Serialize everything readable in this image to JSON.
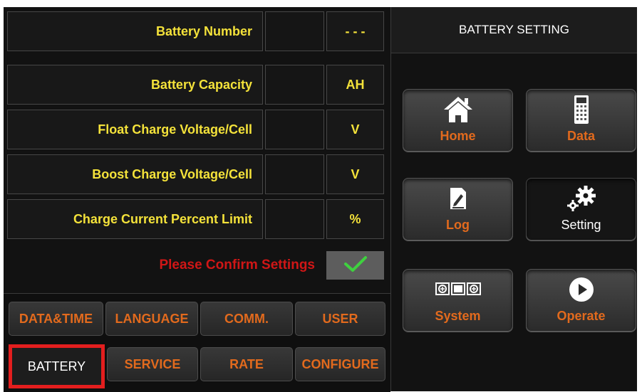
{
  "header": {
    "title": "BATTERY SETTING"
  },
  "rows": [
    {
      "label": "Battery Number",
      "value": "",
      "unit": "- - -"
    },
    {
      "label": "Battery Capacity",
      "value": "",
      "unit": "AH"
    },
    {
      "label": "Float Charge Voltage/Cell",
      "value": "",
      "unit": "V"
    },
    {
      "label": "Boost Charge Voltage/Cell",
      "value": "",
      "unit": "V"
    },
    {
      "label": "Charge Current Percent Limit",
      "value": "",
      "unit": "%"
    }
  ],
  "confirm": {
    "text": "Please Confirm Settings"
  },
  "tabs": [
    {
      "label": "DATA&TIME"
    },
    {
      "label": "LANGUAGE"
    },
    {
      "label": "COMM."
    },
    {
      "label": "USER"
    },
    {
      "label": "BATTERY",
      "active": true
    },
    {
      "label": "SERVICE"
    },
    {
      "label": "RATE"
    },
    {
      "label": "CONFIGURE"
    }
  ],
  "nav": {
    "home": {
      "label": "Home",
      "icon": "home-icon"
    },
    "data": {
      "label": "Data",
      "icon": "data-icon"
    },
    "log": {
      "label": "Log",
      "icon": "log-icon"
    },
    "setting": {
      "label": "Setting",
      "icon": "gears-icon",
      "active": true
    },
    "system": {
      "label": "System",
      "icon": "system-icon"
    },
    "operate": {
      "label": "Operate",
      "icon": "play-icon"
    }
  },
  "colors": {
    "label_yellow": "#f4e23a",
    "accent_orange": "#e26a1d",
    "confirm_red": "#d01616",
    "check_green": "#3fd13f",
    "active_border": "#e31e1e"
  }
}
